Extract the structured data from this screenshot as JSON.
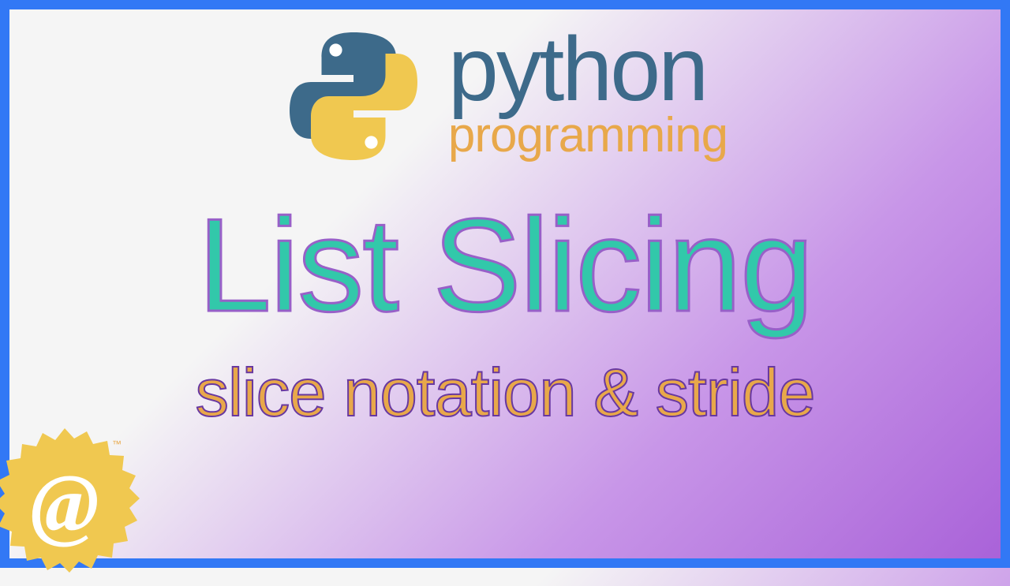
{
  "header": {
    "title": "python",
    "subtitle": "programming"
  },
  "main": {
    "title": "List Slicing",
    "subtitle": "slice notation & stride"
  },
  "badge": {
    "symbol": "@",
    "tm": "™"
  }
}
